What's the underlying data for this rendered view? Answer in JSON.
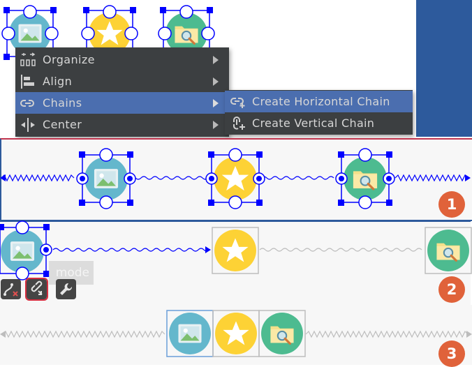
{
  "menu": {
    "items": [
      {
        "label": "Organize",
        "icon": "organize-icon"
      },
      {
        "label": "Align",
        "icon": "align-icon"
      },
      {
        "label": "Chains",
        "icon": "chain-icon"
      },
      {
        "label": "Center",
        "icon": "center-icon"
      }
    ],
    "selected": "Chains"
  },
  "submenu": {
    "items": [
      {
        "label": "Create Horizontal Chain",
        "icon": "horizontal-chain-icon"
      },
      {
        "label": "Create Vertical Chain",
        "icon": "vertical-chain-icon"
      }
    ],
    "selected": "Create Horizontal Chain"
  },
  "steps": {
    "one": "1",
    "two": "2",
    "three": "3"
  },
  "tooltip": {
    "text": "mode"
  },
  "colors": {
    "menu_bg": "#3c3f41",
    "menu_selected": "#4b6eaf",
    "selection_blue": "#0000ff",
    "badge": "#e0623a",
    "blueprint": "#2d5a9c",
    "image_circle": "#64b7cc",
    "star_circle": "#fdd235",
    "search_circle": "#4dbb90"
  },
  "icons": [
    "image-icon",
    "star-icon",
    "search-folder-icon",
    "delete-constraints-icon",
    "chain-tool-icon",
    "wrench-icon"
  ]
}
